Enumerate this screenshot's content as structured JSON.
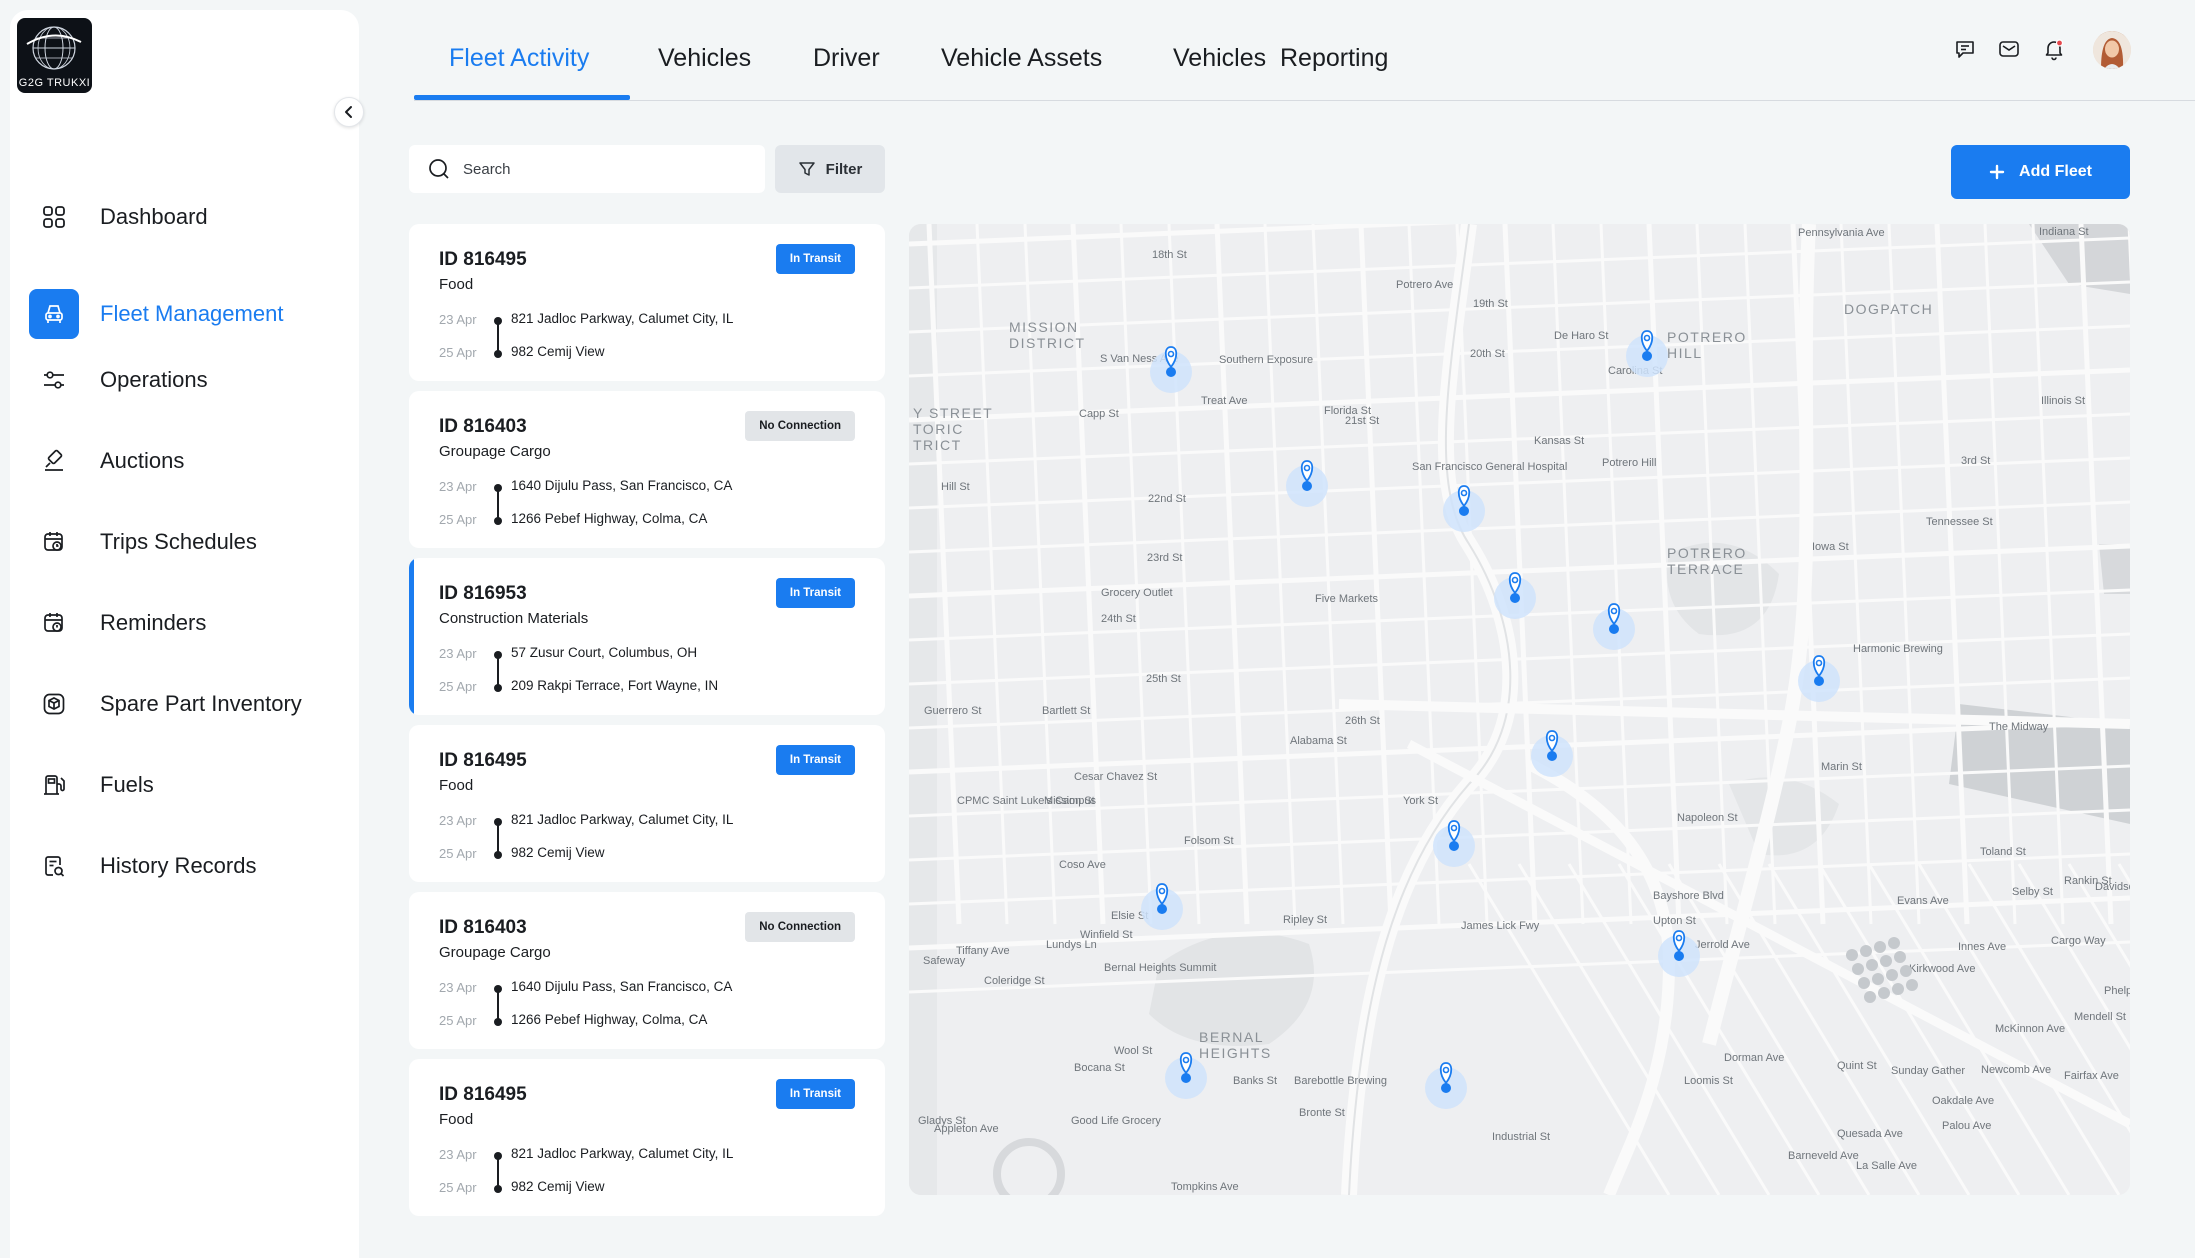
{
  "app": {
    "logo_text": "G2G TRUKXI"
  },
  "sidebar": {
    "items": [
      {
        "label": "Dashboard",
        "icon": "grid-icon",
        "active": false
      },
      {
        "label": "Fleet Management",
        "icon": "fleet-icon",
        "active": true
      },
      {
        "label": "Operations",
        "icon": "sliders-icon",
        "active": false
      },
      {
        "label": "Auctions",
        "icon": "gavel-icon",
        "active": false
      },
      {
        "label": "Trips Schedules",
        "icon": "calendar-clock-icon",
        "active": false
      },
      {
        "label": "Reminders",
        "icon": "calendar-alert-icon",
        "active": false
      },
      {
        "label": "Spare Part Inventory",
        "icon": "box-icon",
        "active": false
      },
      {
        "label": "Fuels",
        "icon": "fuel-icon",
        "active": false
      },
      {
        "label": "History Records",
        "icon": "history-icon",
        "active": false
      }
    ]
  },
  "tabs": [
    {
      "label": "Fleet Activity",
      "active": true
    },
    {
      "label": "Vehicles",
      "active": false
    },
    {
      "label": "Driver",
      "active": false
    },
    {
      "label": "Vehicle Assets",
      "active": false
    },
    {
      "label": "Vehicles  Reporting",
      "active": false
    }
  ],
  "header_icons": [
    "chat-icon",
    "mail-icon",
    "bell-icon"
  ],
  "search": {
    "placeholder": "Search"
  },
  "filter": {
    "label": "Filter"
  },
  "add_fleet": {
    "label": "Add Fleet"
  },
  "fleets": [
    {
      "id": "ID 816495",
      "cargo": "Food",
      "status": "In Transit",
      "status_type": "transit",
      "from_date": "23 Apr",
      "from": "821 Jadloc Parkway, Calumet City, IL",
      "to_date": "25 Apr",
      "to": "982 Cemij View",
      "selected": false
    },
    {
      "id": "ID 816403",
      "cargo": "Groupage Cargo",
      "status": "No Connection",
      "status_type": "noconn",
      "from_date": "23 Apr",
      "from": "1640 Dijulu Pass, San Francisco, CA",
      "to_date": "25 Apr",
      "to": "1266 Pebef Highway, Colma, CA",
      "selected": false
    },
    {
      "id": "ID 816953",
      "cargo": "Construction Materials",
      "status": "In Transit",
      "status_type": "transit",
      "from_date": "23 Apr",
      "from": "57 Zusur Court, Columbus, OH",
      "to_date": "25 Apr",
      "to": "209 Rakpi Terrace, Fort Wayne, IN",
      "selected": true
    },
    {
      "id": "ID 816495",
      "cargo": "Food",
      "status": "In Transit",
      "status_type": "transit",
      "from_date": "23 Apr",
      "from": "821 Jadloc Parkway, Calumet City, IL",
      "to_date": "25 Apr",
      "to": "982 Cemij View",
      "selected": false
    },
    {
      "id": "ID 816403",
      "cargo": "Groupage Cargo",
      "status": "No Connection",
      "status_type": "noconn",
      "from_date": "23 Apr",
      "from": "1640 Dijulu Pass, San Francisco, CA",
      "to_date": "25 Apr",
      "to": "1266 Pebef Highway, Colma, CA",
      "selected": false
    },
    {
      "id": "ID 816495",
      "cargo": "Food",
      "status": "In Transit",
      "status_type": "transit",
      "from_date": "23 Apr",
      "from": "821 Jadloc Parkway, Calumet City, IL",
      "to_date": "25 Apr",
      "to": "982 Cemij View",
      "selected": false
    }
  ],
  "map": {
    "labels": [
      "MISSION",
      "DISTRICT",
      "POTRERO",
      "HILL",
      "DOGPATCH",
      "POTRERO",
      "TERRACE",
      "Y STREET",
      "TORIC",
      "TRICT",
      "BERNAL",
      "HEIGHTS",
      "18th St",
      "19th St",
      "20th St",
      "21st St",
      "22nd St",
      "23rd St",
      "24th St",
      "25th St",
      "26th St",
      "Southern Exposure",
      "San Francisco General Hospital",
      "Potrero Hill",
      "Grocery Outlet",
      "Five Markets",
      "Cesar Chavez St",
      "Harmonic Brewing",
      "The Midway",
      "Marin St",
      "Napoleon St",
      "CPMC Saint Luke's Campus",
      "Bernal Heights Summit",
      "Barebottle Brewing",
      "Good Life Grocery",
      "Sunday Gather",
      "Tompkins Ave",
      "Industrial St",
      "Jerrold Ave",
      "Evans Ave",
      "Ripley St",
      "Hill St",
      "Safeway",
      "Mission St",
      "Folsom St",
      "Alabama St",
      "Potrero Ave",
      "Kansas St",
      "De Haro St",
      "Carolina St",
      "Florida St",
      "Treat Ave",
      "Capp St",
      "S Van Ness Ave",
      "Bartlett St",
      "Guerrero St",
      "Pennsylvania Ave",
      "Indiana St",
      "Illinois St",
      "3rd St",
      "Tennessee St",
      "Iowa St",
      "Toland St",
      "Selby St",
      "Rankin St",
      "Davidson Ave",
      "Cargo Way",
      "Innes Ave",
      "Kirkwood Ave",
      "McKinnon Ave",
      "Newcomb Ave",
      "Oakdale Ave",
      "Palou Ave",
      "Quint St",
      "Phelps St",
      "Mendell St",
      "Fairfax Ave",
      "La Salle Ave",
      "Quesada Ave",
      "Barneveld Ave",
      "Loomis St",
      "Bayshore Blvd",
      "James Lick Fwy",
      "York St",
      "Upton St",
      "Coso Ave",
      "Elsie St",
      "Winfield St",
      "Lundys Ln",
      "Coleridge St",
      "Tiffany Ave",
      "Bocana St",
      "Wool St",
      "Appleton Ave",
      "Gladys St",
      "Banks St",
      "Bronte St",
      "Dorman Ave"
    ]
  }
}
